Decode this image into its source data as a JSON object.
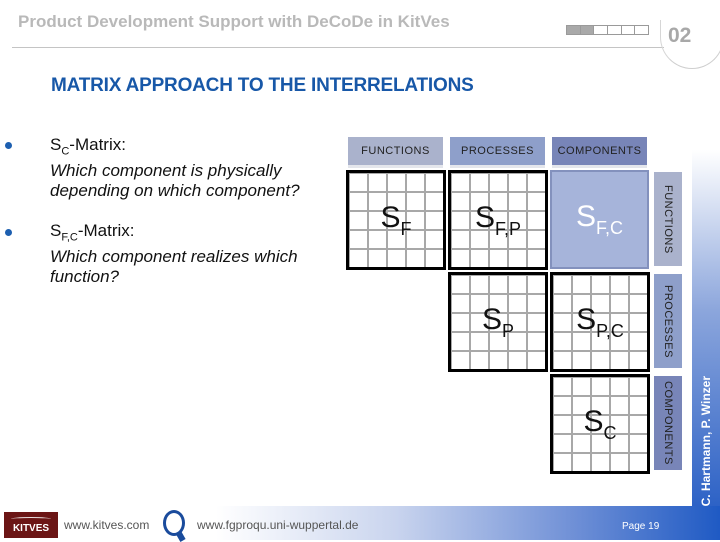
{
  "header": {
    "title": "Product Development Support with DeCoDe in KitVes",
    "section_number": "02",
    "progress": {
      "filled_segments": 2,
      "total_segments": 6
    }
  },
  "section_title": "MATRIX APPROACH TO THE INTERRELATIONS",
  "bullets": [
    {
      "symbol": "S",
      "subscript": "C",
      "suffix": "-Matrix:",
      "question": [
        "Which component is physically",
        "depending on which component?"
      ]
    },
    {
      "symbol": "S",
      "subscript": "F,C",
      "suffix": "-Matrix:",
      "question": [
        "Which component realizes which",
        "function?"
      ]
    }
  ],
  "matrix": {
    "column_labels": [
      "FUNCTIONS",
      "PROCESSES",
      "COMPONENTS"
    ],
    "row_labels": [
      "FUNCTIONS",
      "PROCESSES",
      "COMPONENTS"
    ],
    "cells": [
      {
        "row": 0,
        "col": 0,
        "symbol": "S",
        "subscript": "F",
        "highlighted": false
      },
      {
        "row": 0,
        "col": 1,
        "symbol": "S",
        "subscript": "F,P",
        "highlighted": false
      },
      {
        "row": 0,
        "col": 2,
        "symbol": "S",
        "subscript": "F,C",
        "highlighted": true
      },
      {
        "row": 1,
        "col": 1,
        "symbol": "S",
        "subscript": "P",
        "highlighted": false
      },
      {
        "row": 1,
        "col": 2,
        "symbol": "S",
        "subscript": "P,C",
        "highlighted": false
      },
      {
        "row": 2,
        "col": 2,
        "symbol": "S",
        "subscript": "C",
        "highlighted": false
      }
    ],
    "label_colors": [
      "#aab2cc",
      "#8e9fca",
      "#7885b8"
    ]
  },
  "side_author": "C. Hartmann, P. Winzer",
  "footer": {
    "logo_text": "KITVES",
    "link1": "www.kitves.com",
    "link2": "www.fgproqu.uni-wuppertal.de",
    "page": "Page 19"
  }
}
